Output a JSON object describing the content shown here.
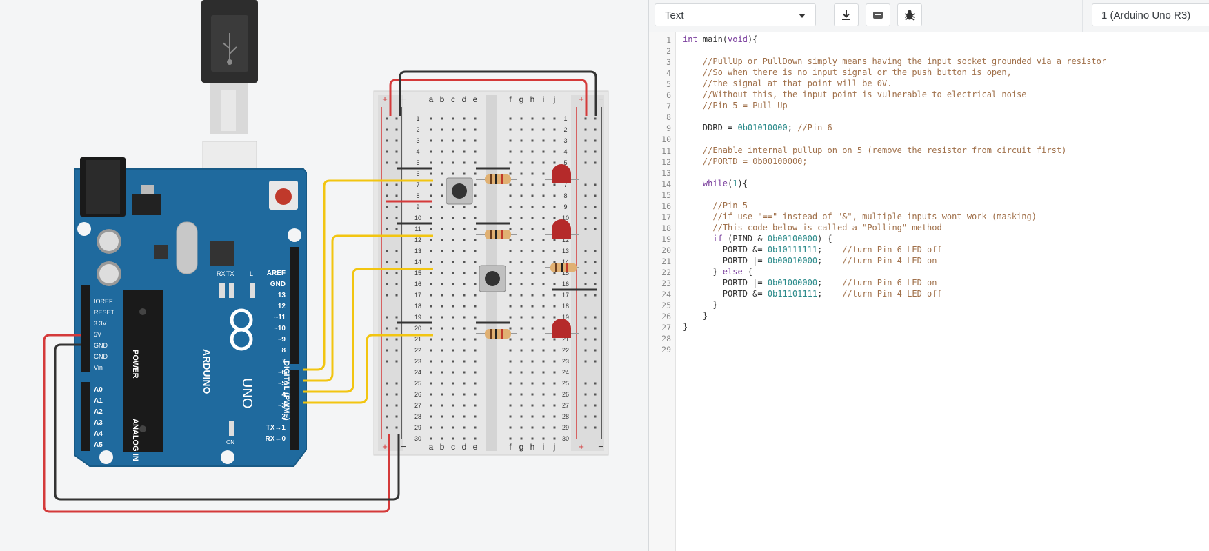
{
  "canvas": {
    "breadboard": {
      "columns_left": [
        "a",
        "b",
        "c",
        "d",
        "e"
      ],
      "columns_right": [
        "f",
        "g",
        "h",
        "i",
        "j"
      ],
      "rows": 30,
      "plus": "+",
      "minus": "−"
    },
    "arduino": {
      "brand": "ARDUINO",
      "model": "UNO",
      "power_label": "POWER",
      "analog_label": "ANALOG IN",
      "digital_label": "DIGITAL (PWM~)",
      "power_pins": [
        "IOREF",
        "RESET",
        "3.3V",
        "5V",
        "GND",
        "GND",
        "Vin"
      ],
      "analog_pins": [
        "A0",
        "A1",
        "A2",
        "A3",
        "A4",
        "A5"
      ],
      "digital_pins": [
        "AREF",
        "GND",
        "13",
        "12",
        "~11",
        "~10",
        "~9",
        "8",
        "7",
        "~6",
        "~5",
        "4",
        "~3",
        "2",
        "TX→1",
        "RX←0"
      ],
      "leds": [
        "TX",
        "RX",
        "L"
      ],
      "on_label": "ON"
    }
  },
  "toolbar": {
    "mode": "Text",
    "download_icon": "download-icon",
    "components_icon": "library-icon",
    "debug_icon": "bug-icon",
    "device": "1 (Arduino Uno R3)"
  },
  "code": {
    "line_numbers": [
      "1",
      "2",
      "3",
      "4",
      "5",
      "6",
      "7",
      "8",
      "9",
      "10",
      "11",
      "12",
      "13",
      "14",
      "15",
      "16",
      "17",
      "18",
      "19",
      "20",
      "21",
      "22",
      "23",
      "24",
      "25",
      "26",
      "27",
      "28",
      "29"
    ],
    "lines": [
      "int main(void){",
      "",
      "    //PullUp or PullDown simply means having the input socket grounded via a resistor",
      "    //So when there is no input signal or the push button is open,",
      "    //the signal at that point will be 0V.",
      "    //Without this, the input point is vulnerable to electrical noise",
      "    //Pin 5 = Pull Up",
      "",
      "    DDRD = 0b01010000; //Pin 6",
      "",
      "    //Enable internal pullup on on 5 (remove the resistor from circuit first)",
      "    //PORTD = 0b00100000;",
      "",
      "    while(1){",
      "",
      "      //Pin 5",
      "      //if use \"==\" instead of \"&\", multiple inputs wont work (masking)",
      "      //This code below is called a \"Polling\" method",
      "      if (PIND & 0b00100000) {",
      "        PORTD &= 0b10111111;    //turn Pin 6 LED off",
      "        PORTD |= 0b00010000;    //turn Pin 4 LED on",
      "      } else {",
      "        PORTD |= 0b01000000;    //turn Pin 6 LED on",
      "        PORTD &= 0b11101111;    //turn Pin 4 LED off",
      "      }",
      "    }",
      "}",
      "",
      ""
    ]
  }
}
